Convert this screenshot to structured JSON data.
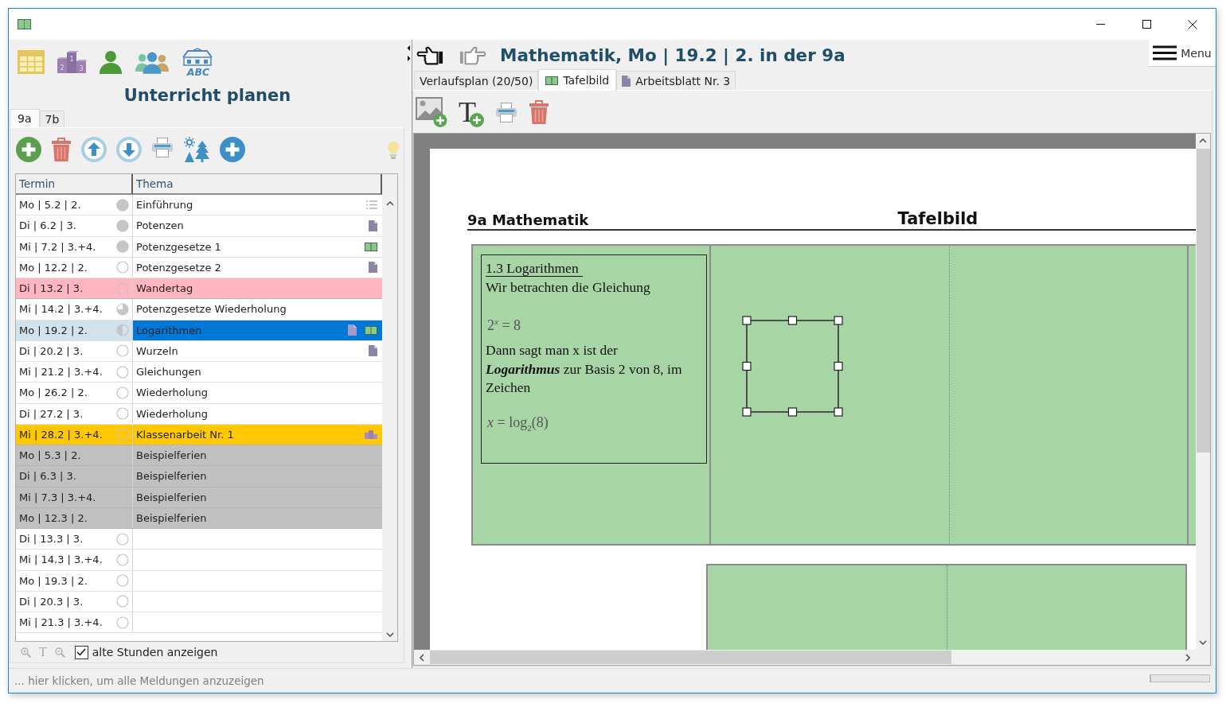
{
  "left_panel": {
    "title": "Unterricht planen",
    "podium_icon_labels": [
      "2",
      "1",
      "3"
    ],
    "class_icon_label": "ABC",
    "class_tabs": [
      {
        "label": "9a",
        "selected": true
      },
      {
        "label": "7b",
        "selected": false
      }
    ],
    "table": {
      "columns": [
        "Termin",
        "Thema"
      ],
      "rows": [
        {
          "date": "Mo | 5.2 | 2.",
          "topic": "Einführung",
          "progress": {
            "kind": "full"
          },
          "selected": false,
          "attachments": [
            {
              "kind": "plan"
            }
          ]
        },
        {
          "date": "Di | 6.2 | 3.",
          "topic": "Potenzen",
          "progress": {
            "kind": "full"
          },
          "selected": false,
          "attachments": [
            {
              "kind": "worksheet"
            }
          ]
        },
        {
          "date": "Mi | 7.2 | 3.+4.",
          "topic": "Potenzgesetze 1",
          "progress": {
            "kind": "full"
          },
          "selected": false,
          "attachments": [
            {
              "kind": "board"
            }
          ]
        },
        {
          "date": "Mo | 12.2 | 2.",
          "topic": "Potenzgesetze 2",
          "progress": {
            "kind": "empty"
          },
          "selected": false,
          "attachments": [
            {
              "kind": "worksheet"
            }
          ]
        },
        {
          "date": "Di | 13.2 | 3.",
          "topic": "Wandertag",
          "progress": {
            "kind": "empty"
          },
          "selected": false,
          "color": "#ffb6c1"
        },
        {
          "date": "Mi | 14.2 | 3.+4.",
          "topic": "Potenzgesetze Wiederholung",
          "progress": {
            "kind": "threequarter"
          },
          "selected": false
        },
        {
          "date": "Mo | 19.2 | 2.",
          "topic": "Logarithmen",
          "progress": {
            "kind": "half"
          },
          "selected": true,
          "attachments": [
            {
              "kind": "worksheet"
            },
            {
              "kind": "board"
            }
          ]
        },
        {
          "date": "Di | 20.2 | 3.",
          "topic": "Wurzeln",
          "progress": {
            "kind": "empty"
          },
          "selected": false,
          "attachments": [
            {
              "kind": "worksheet"
            }
          ]
        },
        {
          "date": "Mi | 21.2 | 3.+4.",
          "topic": "Gleichungen",
          "progress": {
            "kind": "empty"
          },
          "selected": false
        },
        {
          "date": "Mo | 26.2 | 2.",
          "topic": "Wiederholung",
          "progress": {
            "kind": "empty"
          },
          "selected": false
        },
        {
          "date": "Di | 27.2 | 3.",
          "topic": "Wiederholung",
          "progress": {
            "kind": "empty"
          },
          "selected": false
        },
        {
          "date": "Mi | 28.2 | 3.+4.",
          "topic": "Klassenarbeit Nr. 1",
          "progress": {
            "kind": "empty"
          },
          "selected": false,
          "color": "#ffc800",
          "attachments": [
            {
              "kind": "exam"
            }
          ]
        },
        {
          "date": "Mo | 5.3 | 2.",
          "topic": "Beispielferien",
          "selected": false,
          "color": "#c0c0c0"
        },
        {
          "date": "Di | 6.3 | 3.",
          "topic": "Beispielferien",
          "selected": false,
          "color": "#c0c0c0"
        },
        {
          "date": "Mi | 7.3 | 3.+4.",
          "topic": "Beispielferien",
          "selected": false,
          "color": "#c0c0c0"
        },
        {
          "date": "Mo | 12.3 | 2.",
          "topic": "Beispielferien",
          "selected": false,
          "color": "#c0c0c0"
        },
        {
          "date": "Di | 13.3 | 3.",
          "progress": {
            "kind": "empty"
          },
          "selected": false
        },
        {
          "date": "Mi | 14.3 | 3.+4.",
          "progress": {
            "kind": "empty"
          },
          "selected": false
        },
        {
          "date": "Mo | 19.3 | 2.",
          "progress": {
            "kind": "empty"
          },
          "selected": false
        },
        {
          "date": "Di | 20.3 | 3.",
          "progress": {
            "kind": "empty"
          },
          "selected": false
        },
        {
          "date": "Mi | 21.3 | 3.+4.",
          "progress": {
            "kind": "empty"
          },
          "selected": false
        }
      ]
    },
    "footer": {
      "text_tool": "T",
      "show_old": {
        "label": "alte Stunden anzeigen",
        "checked": true
      }
    }
  },
  "right_panel": {
    "title": "Mathematik, Mo | 19.2 | 2. in der 9a",
    "menu": {
      "label": "Menu"
    },
    "tabs": [
      {
        "label": "Verlaufsplan (20/50)",
        "selected": false,
        "kind": "plan"
      },
      {
        "label": "Tafelbild",
        "selected": true,
        "kind": "board"
      },
      {
        "label": "Arbeitsblatt Nr. 3",
        "selected": false,
        "kind": "worksheet"
      }
    ],
    "toolbar": {
      "add_text_tool": "T"
    },
    "page": {
      "heading": "9a Mathematik",
      "title": "Tafelbild",
      "board": {
        "elements": [
          {
            "kind": "text",
            "selected": false,
            "blocks": [
              {
                "kind": "heading",
                "text": "1.3 Logarithmen"
              },
              {
                "kind": "text",
                "text": "Wir betrachten die Gleichung"
              },
              {
                "kind": "formula",
                "text": "2$^{x}$ = 8"
              },
              {
                "kind": "text",
                "text": "Dann sagt man x ist der **Logarithmus** zur Basis 2 von 8, im Zeichen"
              },
              {
                "kind": "formula",
                "text": "*x* = log$_{2}$(8)"
              }
            ]
          },
          {
            "kind": "frame",
            "selected": true
          }
        ]
      }
    }
  },
  "status_bar": {
    "message": "... hier klicken, um alle Meldungen anzuzeigen",
    "progress": {
      "level": 0
    }
  }
}
